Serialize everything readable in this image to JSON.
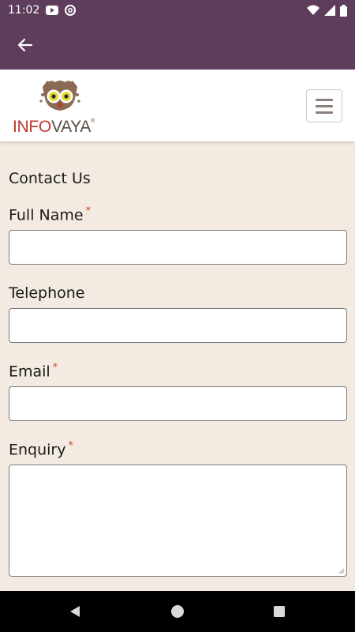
{
  "status_bar": {
    "time": "11:02",
    "left_icons": [
      "youtube-icon",
      "at-sign-icon"
    ],
    "right_icons": [
      "wifi-icon",
      "signal-icon",
      "battery-icon"
    ]
  },
  "app_bar": {
    "back_icon": "arrow-left-icon",
    "color": "#5e3d5c"
  },
  "header": {
    "logo": {
      "text_info": "INFO",
      "text_vaya": "VAYA",
      "registered": "®"
    },
    "menu_icon": "hamburger-icon"
  },
  "form": {
    "heading": "Contact Us",
    "required_marker": "*",
    "fields": [
      {
        "label": "Full Name",
        "required": true,
        "value": "",
        "type": "text"
      },
      {
        "label": "Telephone",
        "required": false,
        "value": "",
        "type": "text"
      },
      {
        "label": "Email",
        "required": true,
        "value": "",
        "type": "text"
      },
      {
        "label": "Enquiry",
        "required": true,
        "value": "",
        "type": "textarea"
      }
    ]
  },
  "nav_bar": {
    "back": "triangle-back-icon",
    "home": "circle-home-icon",
    "recents": "square-recents-icon"
  },
  "colors": {
    "brand_purple": "#5e3d5c",
    "page_background": "#f3ebe1",
    "required_red": "#d3442c"
  }
}
